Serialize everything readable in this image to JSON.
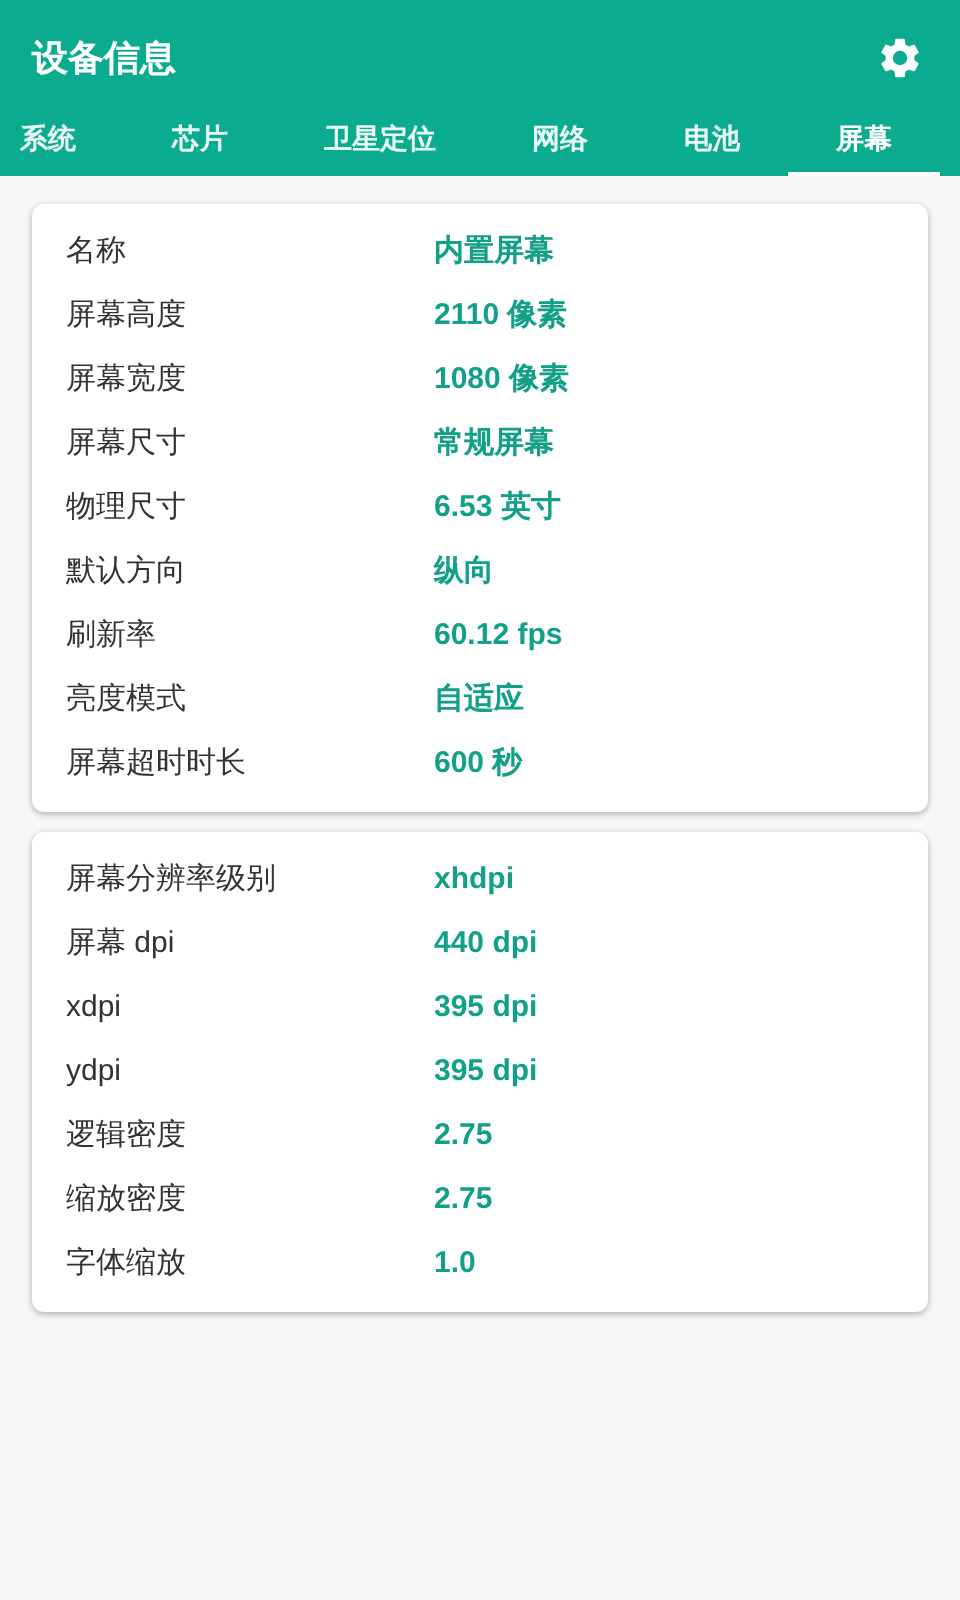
{
  "app_bar": {
    "title": "设备信息"
  },
  "tabs": [
    {
      "label": "系统",
      "selected": false
    },
    {
      "label": "芯片",
      "selected": false
    },
    {
      "label": "卫星定位",
      "selected": false
    },
    {
      "label": "网络",
      "selected": false
    },
    {
      "label": "电池",
      "selected": false
    },
    {
      "label": "屏幕",
      "selected": true
    }
  ],
  "cards": [
    {
      "rows": [
        {
          "label": "名称",
          "value": "内置屏幕"
        },
        {
          "label": "屏幕高度",
          "value": "2110 像素"
        },
        {
          "label": "屏幕宽度",
          "value": "1080 像素"
        },
        {
          "label": "屏幕尺寸",
          "value": "常规屏幕"
        },
        {
          "label": "物理尺寸",
          "value": "6.53 英寸"
        },
        {
          "label": "默认方向",
          "value": "纵向"
        },
        {
          "label": "刷新率",
          "value": "60.12 fps"
        },
        {
          "label": "亮度模式",
          "value": "自适应"
        },
        {
          "label": "屏幕超时时长",
          "value": "600 秒"
        }
      ]
    },
    {
      "rows": [
        {
          "label": "屏幕分辨率级别",
          "value": "xhdpi"
        },
        {
          "label": "屏幕 dpi",
          "value": "440 dpi"
        },
        {
          "label": "xdpi",
          "value": "395 dpi"
        },
        {
          "label": "ydpi",
          "value": "395 dpi"
        },
        {
          "label": "逻辑密度",
          "value": "2.75"
        },
        {
          "label": "缩放密度",
          "value": "2.75"
        },
        {
          "label": "字体缩放",
          "value": "1.0"
        }
      ]
    }
  ]
}
